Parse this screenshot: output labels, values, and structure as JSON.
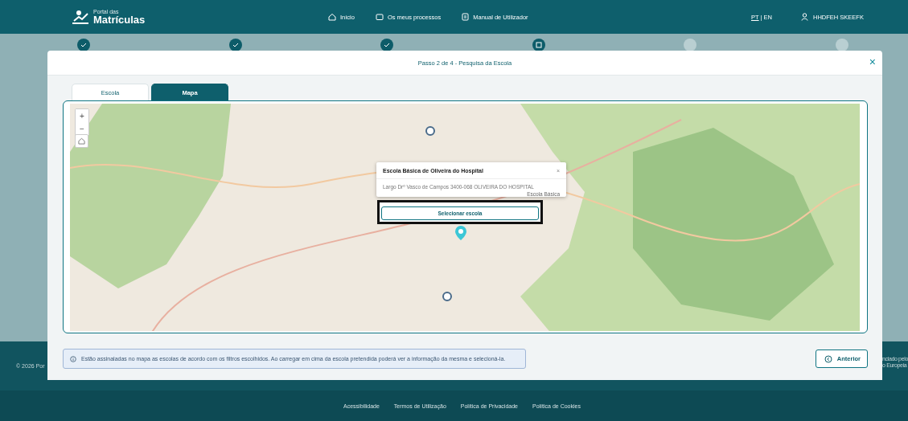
{
  "header": {
    "logo_small": "Portal das",
    "logo_big": "Matrículas",
    "nav": [
      {
        "label": "Início"
      },
      {
        "label": "Os meus processos"
      },
      {
        "label": "Manual de Utilizador"
      }
    ],
    "languages": [
      {
        "label": "PT",
        "selected": true
      },
      {
        "label": "EN",
        "selected": false
      }
    ],
    "language_separator": "|",
    "user": "HHDFEH SKEEFK"
  },
  "steps": [
    {
      "kind": "done"
    },
    {
      "kind": "done"
    },
    {
      "kind": "done"
    },
    {
      "kind": "current"
    },
    {
      "kind": "todo"
    },
    {
      "kind": "todo"
    }
  ],
  "modal": {
    "title": "Passo 2 de 4 - Pesquisa da Escola",
    "close": "×",
    "tabs": [
      {
        "label": "Escola",
        "selected": false
      },
      {
        "label": "Mapa",
        "selected": true
      }
    ],
    "map": {
      "zoom_in": "+",
      "zoom_out": "−",
      "popup": {
        "title": "Escola Básica de Oliveira do Hospital",
        "close": "×",
        "address": "Largo Drº Vasco de Campos 3400-068 OLIVEIRA DO HOSPITAL",
        "type": "Escola Básica",
        "button": "Selecionar escola"
      }
    },
    "info": "Estão assinaladas no mapa as escolas de acordo com os filtros escolhidos. Ao carregar em cima da escola pretendida poderá ver a informação da mesma e selecioná-la.",
    "back_button": "Anterior"
  },
  "footer": {
    "copyright": "© 2026 Por",
    "right_lines": [
      "nciado pelo",
      "o Europeia"
    ],
    "links": [
      "Acessibilidade",
      "Termos de Utilização",
      "Política de Privacidade",
      "Política de Cookies"
    ]
  }
}
